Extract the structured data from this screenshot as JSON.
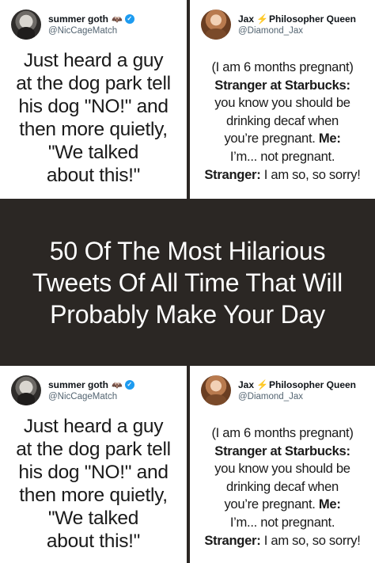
{
  "tweets": {
    "summer": {
      "name": "summer goth",
      "handle": "@NicCageMatch",
      "text": [
        "Just heard a guy",
        "at the dog park tell",
        "his dog \"NO!\" and",
        "then more quietly,",
        "\"We talked",
        "about this!\""
      ]
    },
    "jax": {
      "name": "Jax",
      "name_suffix": "Philosopher Queen",
      "handle": "@Diamond_Jax",
      "line1": "(I am 6 months pregnant)",
      "line2": "Stranger at Starbucks:",
      "line3": "you know you should be",
      "line4": "drinking decaf when",
      "line5_text": "you’re pregnant.",
      "line5_bold": "Me:",
      "line6": "I’m... not pregnant.",
      "line7_bold": "Stranger:",
      "line7_text": "I am so, so sorry!"
    }
  },
  "banner": {
    "title": "50 Of The Most Hilarious Tweets Of All Time That Will Probably Make Your Day"
  },
  "icons": {
    "verified": "verified-badge-icon",
    "bolt": "lightning-bolt-icon",
    "batcat": "bat-cat-icon"
  },
  "colors": {
    "background": "#2b2724",
    "panel": "#ffffff",
    "verified": "#1d9bf0",
    "bolt": "#f5a623"
  }
}
